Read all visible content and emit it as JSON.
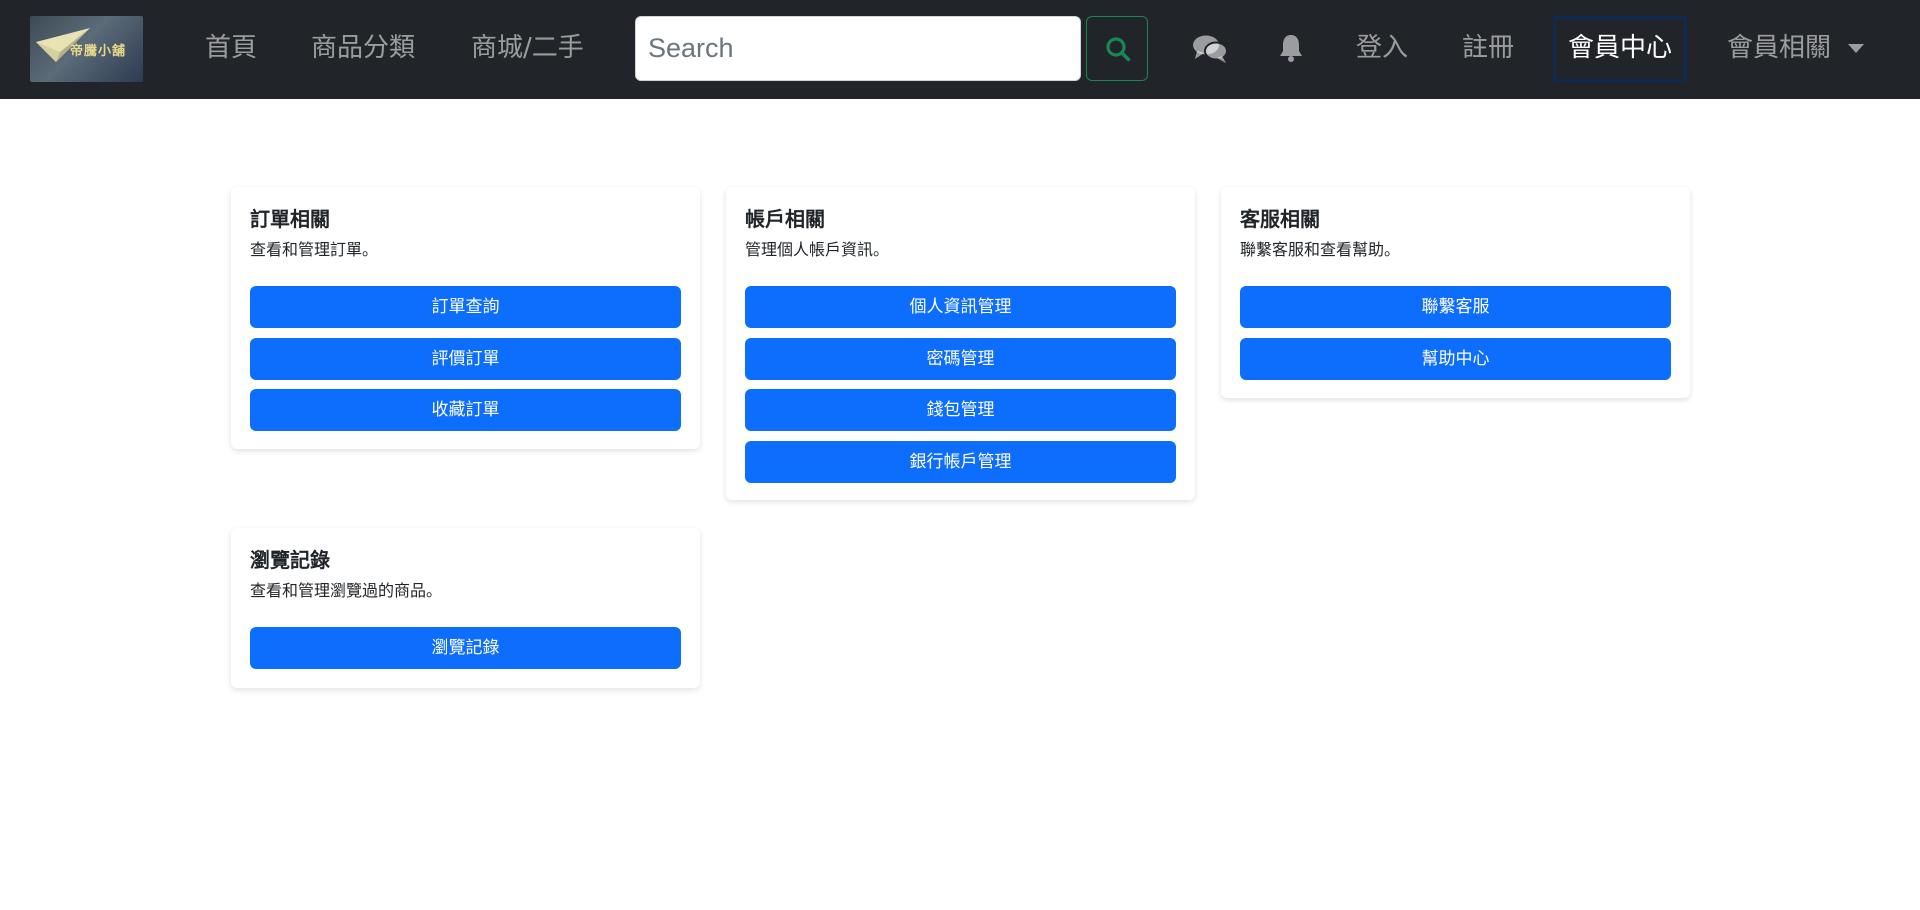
{
  "navbar": {
    "logo_text": "帝騰小舖",
    "links": [
      "首頁",
      "商品分類",
      "商城/二手"
    ],
    "search": {
      "placeholder": "Search",
      "value": ""
    },
    "search_button_icon": "search-icon",
    "chat_icon": "comments-icon",
    "bell_icon": "bell-icon",
    "login": "登入",
    "register": "註冊",
    "member_center": "會員中心",
    "member_related": "會員相關"
  },
  "cards": [
    {
      "title": "訂單相關",
      "text": "查看和管理訂單。",
      "buttons": [
        "訂單查詢",
        "評價訂單",
        "收藏訂單"
      ]
    },
    {
      "title": "帳戶相關",
      "text": "管理個人帳戶資訊。",
      "buttons": [
        "個人資訊管理",
        "密碼管理",
        "錢包管理",
        "銀行帳戶管理"
      ]
    },
    {
      "title": "客服相關",
      "text": "聯繫客服和查看幫助。",
      "buttons": [
        "聯繫客服",
        "幫助中心"
      ]
    },
    {
      "title": "瀏覽記錄",
      "text": "查看和管理瀏覽過的商品。",
      "buttons": [
        "瀏覽記錄"
      ]
    }
  ],
  "colors": {
    "navbar_bg": "#212529",
    "primary": "#0d6efd",
    "search_outline": "#198754"
  }
}
